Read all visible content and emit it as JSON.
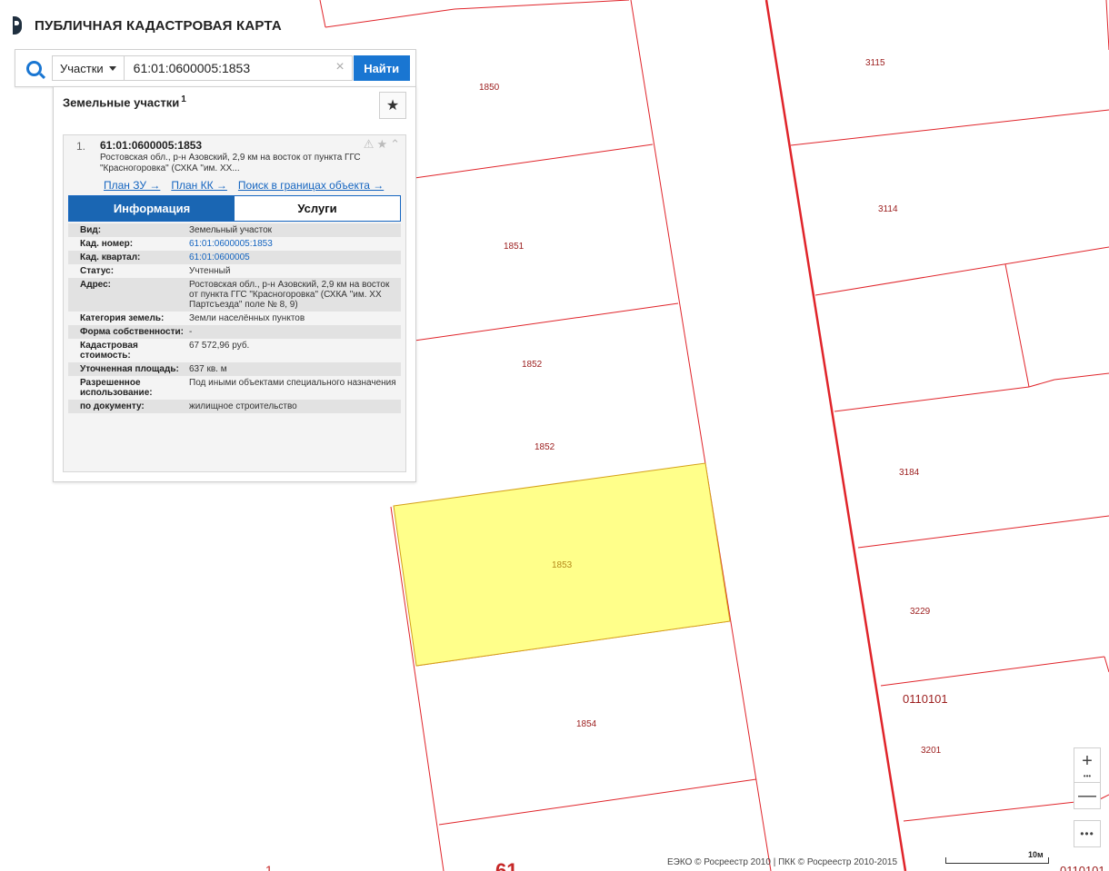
{
  "header": {
    "title": "ПУБЛИЧНАЯ КАДАСТРОВАЯ КАРТА"
  },
  "search": {
    "type_label": "Участки",
    "value": "61:01:0600005:1853",
    "clear": "×",
    "find_label": "Найти"
  },
  "panel": {
    "title": "Земельные участки",
    "count": "1",
    "fav_symbol": "★",
    "result": {
      "num": "1.",
      "cad_number": "61:01:0600005:1853",
      "address_short": "Ростовская обл., р-н Азовский, 2,9 км на восток от пункта ГГС \"Красногоровка\" (СХКА \"им. ХХ...",
      "tools": [
        "⚠",
        "★",
        "⌃"
      ],
      "links": [
        "План ЗУ →",
        "План КК →",
        "Поиск в границах объекта →"
      ],
      "tabs": [
        "Информация",
        "Услуги"
      ],
      "attributes": [
        {
          "k": "Вид:",
          "v": "Земельный участок"
        },
        {
          "k": "Кад. номер:",
          "v": "61:01:0600005:1853"
        },
        {
          "k": "Кад. квартал:",
          "v": "61:01:0600005"
        },
        {
          "k": "Статус:",
          "v": "Учтенный"
        },
        {
          "k": "Адрес:",
          "v": "Ростовская обл., р-н Азовский, 2,9 км на восток от пункта ГГС \"Красногоровка\" (СХКА \"им. ХХ Партсъезда\" поле № 8, 9)"
        },
        {
          "k": "Категория земель:",
          "v": "Земли населённых пунктов"
        },
        {
          "k": "Форма собственности:",
          "v": "-"
        },
        {
          "k": "Кадастровая стоимость:",
          "v": "67 572,96 руб."
        },
        {
          "k": "Уточненная площадь:",
          "v": "637 кв. м"
        },
        {
          "k": "Разрешенное использование:",
          "v": "Под иными объектами специального назначения"
        },
        {
          "k": "по документу:",
          "v": "жилищное строительство"
        }
      ]
    }
  },
  "map": {
    "parcel_labels": [
      "1850",
      "1851",
      "1852",
      "1852",
      "1853",
      "1854",
      "3115",
      "3114",
      "3184",
      "3229",
      "3201"
    ],
    "block_label": "0110101",
    "block_label_cut": "0110101",
    "edge_labels": [
      "1",
      "61"
    ],
    "colors": {
      "boundary": "#e0242a",
      "selected_fill": "#ffff8a",
      "selected_stroke": "#d4a017"
    }
  },
  "controls": {
    "zoom_in": "+",
    "zoom_dots": "•••",
    "zoom_out": "—",
    "more": "•••"
  },
  "footer": {
    "attribution": "ЕЭКО © Росреестр 2010 | ПКК © Росреестр 2010-2015",
    "scale": "10м"
  }
}
